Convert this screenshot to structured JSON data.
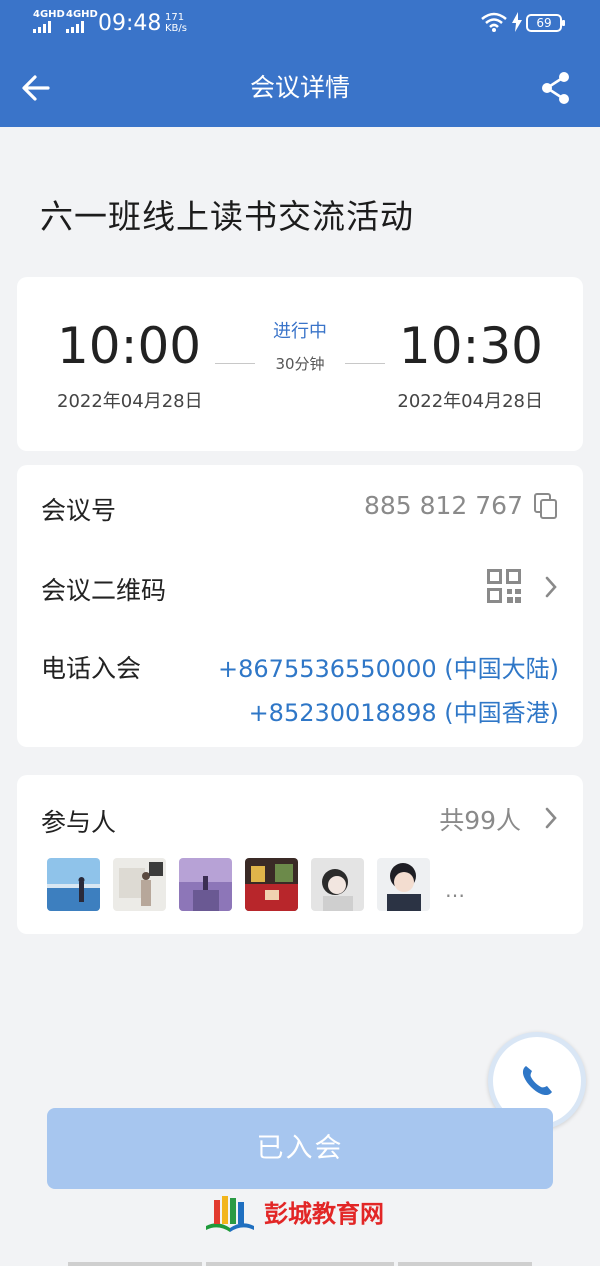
{
  "status_bar": {
    "signal1": "4GHD",
    "signal2": "4GHD",
    "time": "09:48",
    "speed_value": "171",
    "speed_unit": "KB/s",
    "battery": "69"
  },
  "header": {
    "title": "会议详情",
    "back_icon": "arrow-left-icon",
    "share_icon": "share-icon",
    "bg_color": "#3a74c9"
  },
  "meeting": {
    "name": "六一班线上读书交流活动"
  },
  "time_card": {
    "start_time": "10:00",
    "start_date": "2022年04月28日",
    "status": "进行中",
    "duration": "30分钟",
    "end_time": "10:30",
    "end_date": "2022年04月28日"
  },
  "info_card": {
    "id_label": "会议号",
    "id_value": "885 812 767",
    "qr_label": "会议二维码",
    "phone_label": "电话入会",
    "phones": [
      "+8675536550000 (中国大陆)",
      "+85230018898 (中国香港)"
    ]
  },
  "participants": {
    "label": "参与人",
    "count": "共99人",
    "more": "…",
    "avatars": [
      "avatar-1",
      "avatar-2",
      "avatar-3",
      "avatar-4",
      "avatar-5",
      "avatar-6"
    ]
  },
  "actions": {
    "joined_label": "已入会",
    "call_icon": "phone-icon"
  },
  "watermark": {
    "text": "彭城教育网"
  }
}
